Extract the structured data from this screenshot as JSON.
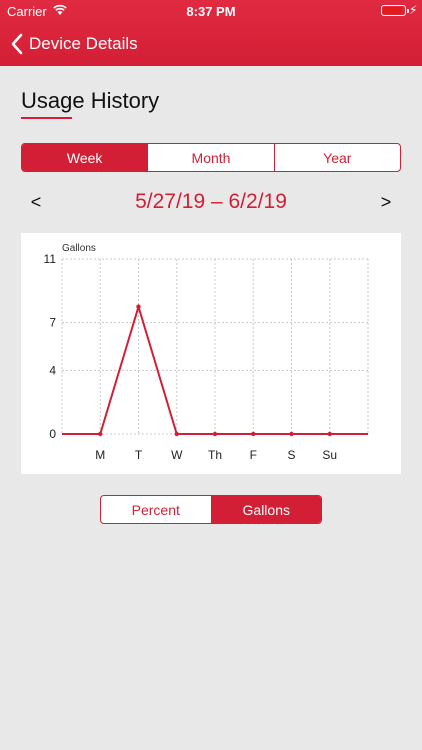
{
  "status_bar": {
    "carrier": "Carrier",
    "time": "8:37 PM"
  },
  "nav": {
    "back_label": "Device Details"
  },
  "section": {
    "title": "Usage History"
  },
  "period_tabs": [
    {
      "label": "Week",
      "active": true
    },
    {
      "label": "Month",
      "active": false
    },
    {
      "label": "Year",
      "active": false
    }
  ],
  "date_nav": {
    "prev": "<",
    "range": "5/27/19 – 6/2/19",
    "next": ">"
  },
  "unit_tabs": [
    {
      "label": "Percent",
      "active": false
    },
    {
      "label": "Gallons",
      "active": true
    }
  ],
  "colors": {
    "accent": "#d31f35",
    "background": "#e8e8e8"
  },
  "chart_data": {
    "type": "line",
    "ylabel": "Gallons",
    "x": [
      "",
      "M",
      "T",
      "W",
      "Th",
      "F",
      "S",
      "Su",
      ""
    ],
    "series": [
      {
        "values": [
          0,
          0,
          8,
          0,
          0,
          0,
          0,
          0,
          0
        ]
      }
    ],
    "yticks": [
      0,
      4,
      7,
      11
    ],
    "ylim": [
      0,
      11
    ],
    "grid": true
  }
}
